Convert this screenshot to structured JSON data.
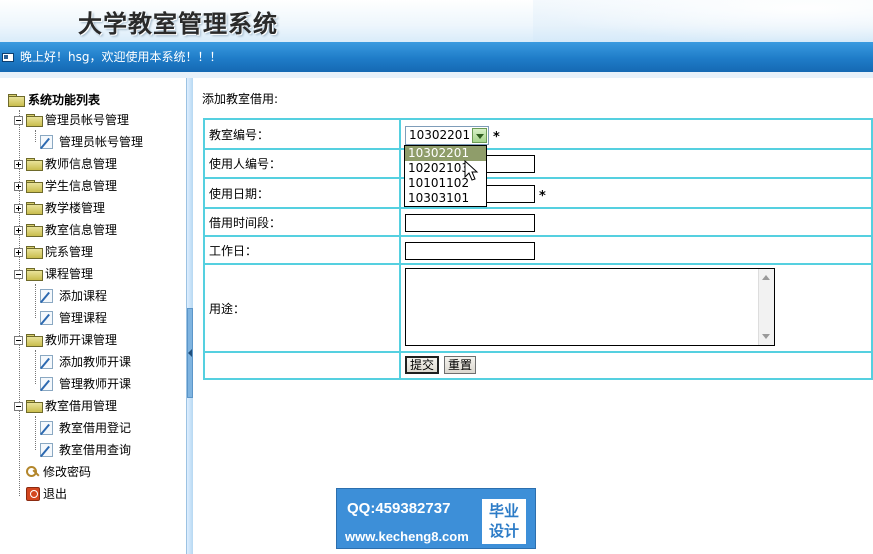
{
  "app": {
    "title": "大学教室管理系统",
    "welcome": "晚上好！hsg，欢迎使用本系统！！！"
  },
  "sidebar": {
    "root": "系统功能列表",
    "items": [
      {
        "label": "管理员帐号管理",
        "type": "folder",
        "expanded": true
      },
      {
        "label": "管理员帐号管理",
        "type": "page"
      },
      {
        "label": "教师信息管理",
        "type": "folder",
        "expanded": false
      },
      {
        "label": "学生信息管理",
        "type": "folder",
        "expanded": false
      },
      {
        "label": "教学楼管理",
        "type": "folder",
        "expanded": false
      },
      {
        "label": "教室信息管理",
        "type": "folder",
        "expanded": false
      },
      {
        "label": "院系管理",
        "type": "folder",
        "expanded": false
      },
      {
        "label": "课程管理",
        "type": "folder",
        "expanded": true
      },
      {
        "label": "添加课程",
        "type": "page"
      },
      {
        "label": "管理课程",
        "type": "page"
      },
      {
        "label": "教师开课管理",
        "type": "folder",
        "expanded": true
      },
      {
        "label": "添加教师开课",
        "type": "page"
      },
      {
        "label": "管理教师开课",
        "type": "page"
      },
      {
        "label": "教室借用管理",
        "type": "folder",
        "expanded": true
      },
      {
        "label": "教室借用登记",
        "type": "page"
      },
      {
        "label": "教室借用查询",
        "type": "page"
      },
      {
        "label": "修改密码",
        "type": "key"
      },
      {
        "label": "退出",
        "type": "power"
      }
    ]
  },
  "main": {
    "heading": "添加教室借用:",
    "form": {
      "room_label": "教室编号：",
      "room_selected": "10302201",
      "room_options": [
        "10302201",
        "10202103",
        "10101102",
        "10303101"
      ],
      "user_label": "使用人编号：",
      "date_label": "使用日期：",
      "period_label": "借用时间段：",
      "workday_label": "工作日：",
      "usage_label": "用途：",
      "required_mark": "*",
      "submit_label": "提交",
      "reset_label": "重置"
    }
  },
  "watermark": {
    "qq": "QQ:459382737",
    "site": "www.kecheng8.com",
    "badge_line1": "毕业",
    "badge_line2": "设计"
  },
  "colors": {
    "header_bar": "#1f7cc8",
    "table_border": "#55d0e0",
    "selected_option": "#8f9d6a",
    "watermark_bg": "#3d8fd8"
  }
}
